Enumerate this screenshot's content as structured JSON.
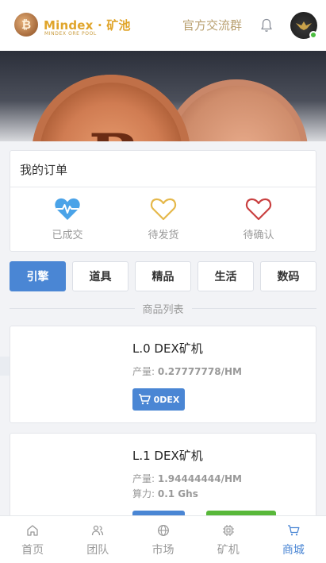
{
  "header": {
    "brand_name": "Mindex · 矿池",
    "brand_tagline": "MINDEX ORE POOL",
    "group_link": "官方交流群",
    "notification_icon": "bell-icon"
  },
  "orders": {
    "title": "我的订单",
    "items": [
      {
        "label": "已成交",
        "icon": "heartbeat-icon",
        "color": "#4aa3e8"
      },
      {
        "label": "待发货",
        "icon": "heart-outline-icon",
        "color": "#e5b84a"
      },
      {
        "label": "待确认",
        "icon": "heart-outline-icon",
        "color": "#c94040"
      }
    ]
  },
  "tabs": [
    {
      "label": "引擎",
      "active": true
    },
    {
      "label": "道具",
      "active": false
    },
    {
      "label": "精品",
      "active": false
    },
    {
      "label": "生活",
      "active": false
    },
    {
      "label": "数码",
      "active": false
    }
  ],
  "section_title": "商品列表",
  "products": [
    {
      "name": "L.0 DEX矿机",
      "attrs": [
        {
          "key": "产量:",
          "value": "0.27777778/HM"
        }
      ],
      "buy_label": "0DEX"
    },
    {
      "name": "L.1 DEX矿机",
      "attrs": [
        {
          "key": "产量:",
          "value": "1.94444444/HM"
        },
        {
          "key": "算力:",
          "value": "0.1 Ghs"
        }
      ]
    }
  ],
  "bottom_nav": [
    {
      "label": "首页",
      "icon": "home-icon",
      "active": false
    },
    {
      "label": "团队",
      "icon": "team-icon",
      "active": false
    },
    {
      "label": "市场",
      "icon": "globe-icon",
      "active": false
    },
    {
      "label": "矿机",
      "icon": "chip-icon",
      "active": false
    },
    {
      "label": "商城",
      "icon": "cart-icon",
      "active": true
    }
  ],
  "colors": {
    "accent": "#4a86d4",
    "brand_gold": "#e0a52b",
    "active_nav": "#4a86d4"
  }
}
